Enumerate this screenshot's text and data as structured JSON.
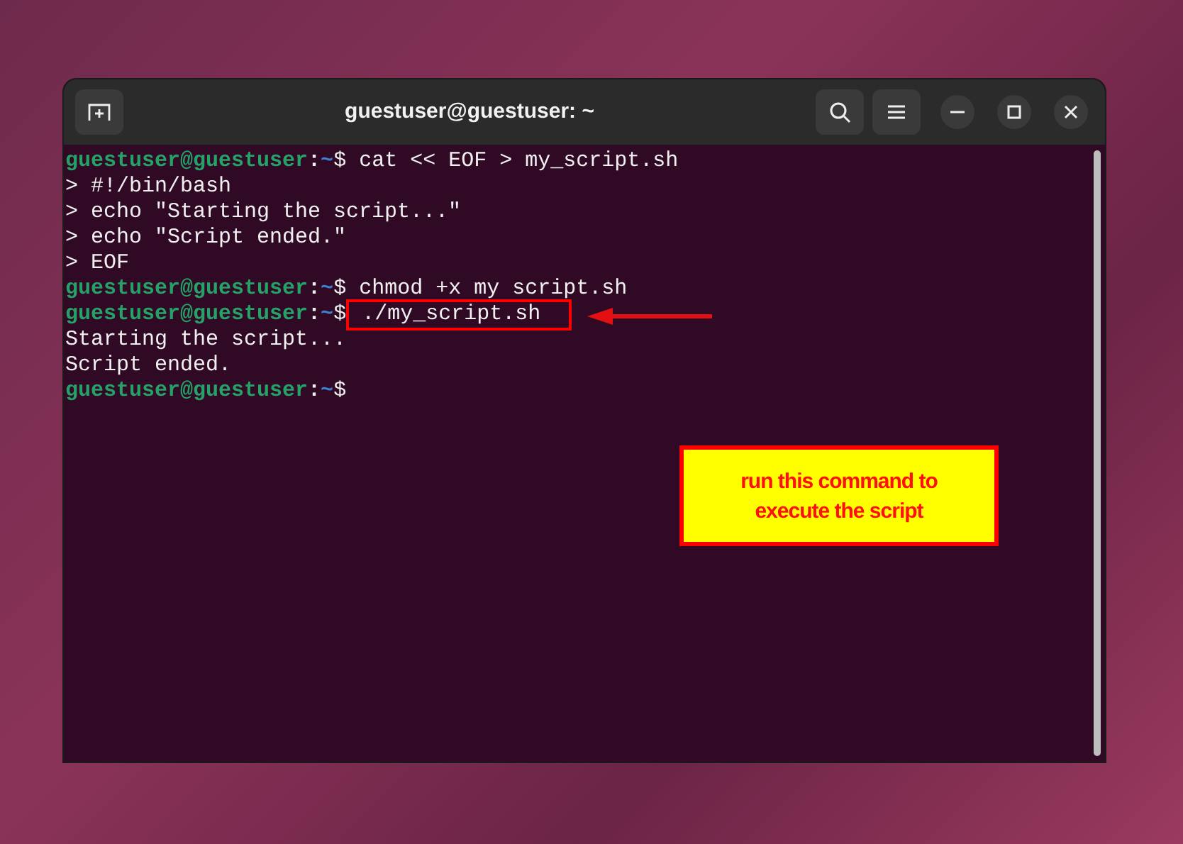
{
  "window": {
    "title": "guestuser@guestuser: ~"
  },
  "lines": [
    {
      "kind": "prompt",
      "user": "guestuser@guestuser",
      "colon": ":",
      "path": "~",
      "symbol": "$",
      "command": "cat << EOF > my_script.sh",
      "highlighted": false
    },
    {
      "kind": "output",
      "text": "> #!/bin/bash"
    },
    {
      "kind": "output",
      "text": "> echo \"Starting the script...\""
    },
    {
      "kind": "output",
      "text": "> echo \"Script ended.\""
    },
    {
      "kind": "output",
      "text": "> EOF"
    },
    {
      "kind": "prompt",
      "user": "guestuser@guestuser",
      "colon": ":",
      "path": "~",
      "symbol": "$",
      "command": "chmod +x my script.sh",
      "highlighted": false
    },
    {
      "kind": "prompt",
      "user": "guestuser@guestuser",
      "colon": ":",
      "path": "~",
      "symbol": "$",
      "command": "./my_script.sh",
      "highlighted": true
    },
    {
      "kind": "output",
      "text": "Starting the script..."
    },
    {
      "kind": "output",
      "text": "Script ended."
    },
    {
      "kind": "prompt",
      "user": "guestuser@guestuser",
      "colon": ":",
      "path": "~",
      "symbol": "$",
      "highlighted": false
    }
  ],
  "annotation": {
    "text": "run this command to execute the script"
  }
}
